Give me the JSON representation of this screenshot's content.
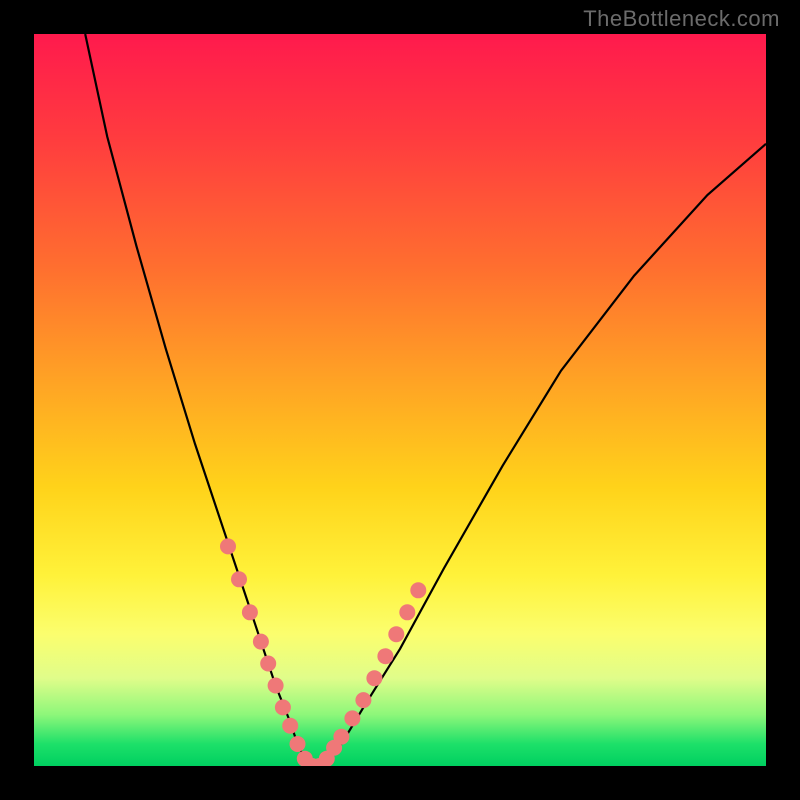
{
  "meta": {
    "watermark_text": "TheBottleneck.com"
  },
  "chart_data": {
    "type": "line",
    "title": "",
    "xlabel": "",
    "ylabel": "",
    "xlim": [
      0,
      100
    ],
    "ylim": [
      0,
      100
    ],
    "background": "red-yellow-green vertical gradient",
    "series": [
      {
        "name": "bottleneck-curve",
        "color": "#000000",
        "x": [
          7,
          10,
          14,
          18,
          22,
          26,
          29,
          31,
          33,
          35,
          36,
          37,
          38,
          39,
          40,
          42,
          45,
          50,
          56,
          64,
          72,
          82,
          92,
          100
        ],
        "y": [
          100,
          86,
          71,
          57,
          44,
          32,
          23,
          17,
          11,
          6,
          3,
          1,
          0,
          0,
          1,
          3,
          8,
          16,
          27,
          41,
          54,
          67,
          78,
          85
        ]
      }
    ],
    "marker_points": {
      "name": "highlighted-points",
      "color": "#ef7878",
      "x": [
        26.5,
        28.0,
        29.5,
        31.0,
        32.0,
        33.0,
        34.0,
        35.0,
        36.0,
        37.0,
        38.0,
        39.0,
        40.0,
        41.0,
        42.0,
        43.5,
        45.0,
        46.5,
        48.0,
        49.5,
        51.0,
        52.5
      ],
      "y": [
        30,
        25.5,
        21,
        17,
        14,
        11,
        8,
        5.5,
        3,
        1,
        0,
        0,
        1,
        2.5,
        4,
        6.5,
        9,
        12,
        15,
        18,
        21,
        24
      ]
    }
  },
  "colors": {
    "frame": "#000000",
    "curve": "#000000",
    "marker_fill": "#ef7878",
    "watermark": "#6b6b6b"
  }
}
